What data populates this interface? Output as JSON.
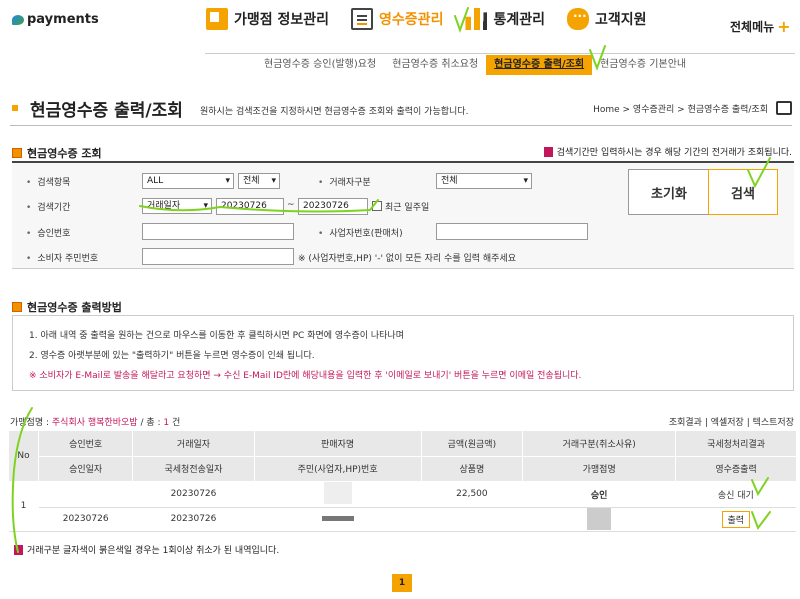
{
  "brand": {
    "logo_text": "payments"
  },
  "topnav": {
    "items": [
      {
        "label": "가맹점 정보관리",
        "icon": "store-icon"
      },
      {
        "label": "영수증관리",
        "icon": "receipt-icon",
        "active": true
      },
      {
        "label": "통계관리",
        "icon": "bar-chart-icon"
      },
      {
        "label": "고객지원",
        "icon": "chat-icon"
      }
    ],
    "all_menu": "전체메뉴"
  },
  "subnav": {
    "items": [
      {
        "label": "현금영수증 승인(발행)요청"
      },
      {
        "label": "현금영수증 취소요청"
      },
      {
        "label": "현금영수증 출력/조회",
        "active": true
      },
      {
        "label": "현금영수증 기본안내"
      }
    ]
  },
  "page": {
    "title": "현금영수증 출력/조회",
    "description": "원하시는 검색조건을 지정하시면 현금영수증 조회와 출력이 가능합니다.",
    "breadcrumb": "Home > 영수증관리 > 현금영수증 출력/조회"
  },
  "search": {
    "section_title": "현금영수증 조회",
    "notice": "검색기간만 입력하시는 경우 해당 기간의 전거래가 조회됩니다.",
    "labels": {
      "item": "검색항목",
      "period": "검색기간",
      "approval_no": "승인번호",
      "consumer_id": "소비자 주민번호",
      "trader_type": "거래자구분",
      "biz_no": "사업자번호(판매처)"
    },
    "item_select": "ALL",
    "item_sub_select": "전체",
    "trader_type_select": "전체",
    "period_type_select": "거래일자",
    "date_from": "20230726",
    "date_to": "20230726",
    "date_sep": "~",
    "recent_week": "최근 일주일",
    "consumer_hint": "※ (사업자번호,HP) '-' 없이 모든 자리 수를 입력 해주세요",
    "reset_label": "초기화",
    "search_label": "검색"
  },
  "howto": {
    "section_title": "현금영수증 출력방법",
    "lines": [
      "1. 아래 내역 중 출력을 원하는 건으로 마우스를 이동한 후 클릭하시면 PC 화면에 영수증이 나타나며",
      "2. 영수증 아랫부분에 있는 \"출력하기\" 버튼을 누르면 영수증이 인쇄 됩니다.",
      "※ 소비자가 E-Mail로 발송을 해달라고 요청하면 → 수신 E-Mail ID란에 해당내용을 입력한 후 '이메일로 보내기' 버튼을 누르면 이메일 전송됩니다."
    ]
  },
  "results": {
    "merchant_label": "가맹점명 :",
    "merchant_name": "주식회사 행복한바오밥",
    "total_label": "/ 총 :",
    "total_count": "1",
    "total_unit": "건",
    "links": "조회결과 | 엑셀저장 | 텍스트저장",
    "headers_row1": [
      "No",
      "승인번호",
      "거래일자",
      "판매자명",
      "금액(원금액)",
      "거래구분(취소사유)",
      "국세청처리결과"
    ],
    "headers_row2": [
      "승인일자",
      "국세청전송일자",
      "주민(사업자,HP)번호",
      "상품명",
      "가맹점명",
      "영수증출력"
    ],
    "row": {
      "no": "1",
      "approval_no": "",
      "trade_date": "20230726",
      "amount": "22,500",
      "trade_type": "승인",
      "nts_result": "송신 대기",
      "approval_date": "20230726",
      "nts_send_date": "20230726",
      "print_label": "출력"
    },
    "footnote": "거래구분 글자색이 붉은색일 경우는 1회이상 취소가 된 내역입니다.",
    "page": "1"
  },
  "colors": {
    "accent": "#f4a300",
    "highlight": "#c2185b",
    "check_marks": "#7ed321"
  }
}
